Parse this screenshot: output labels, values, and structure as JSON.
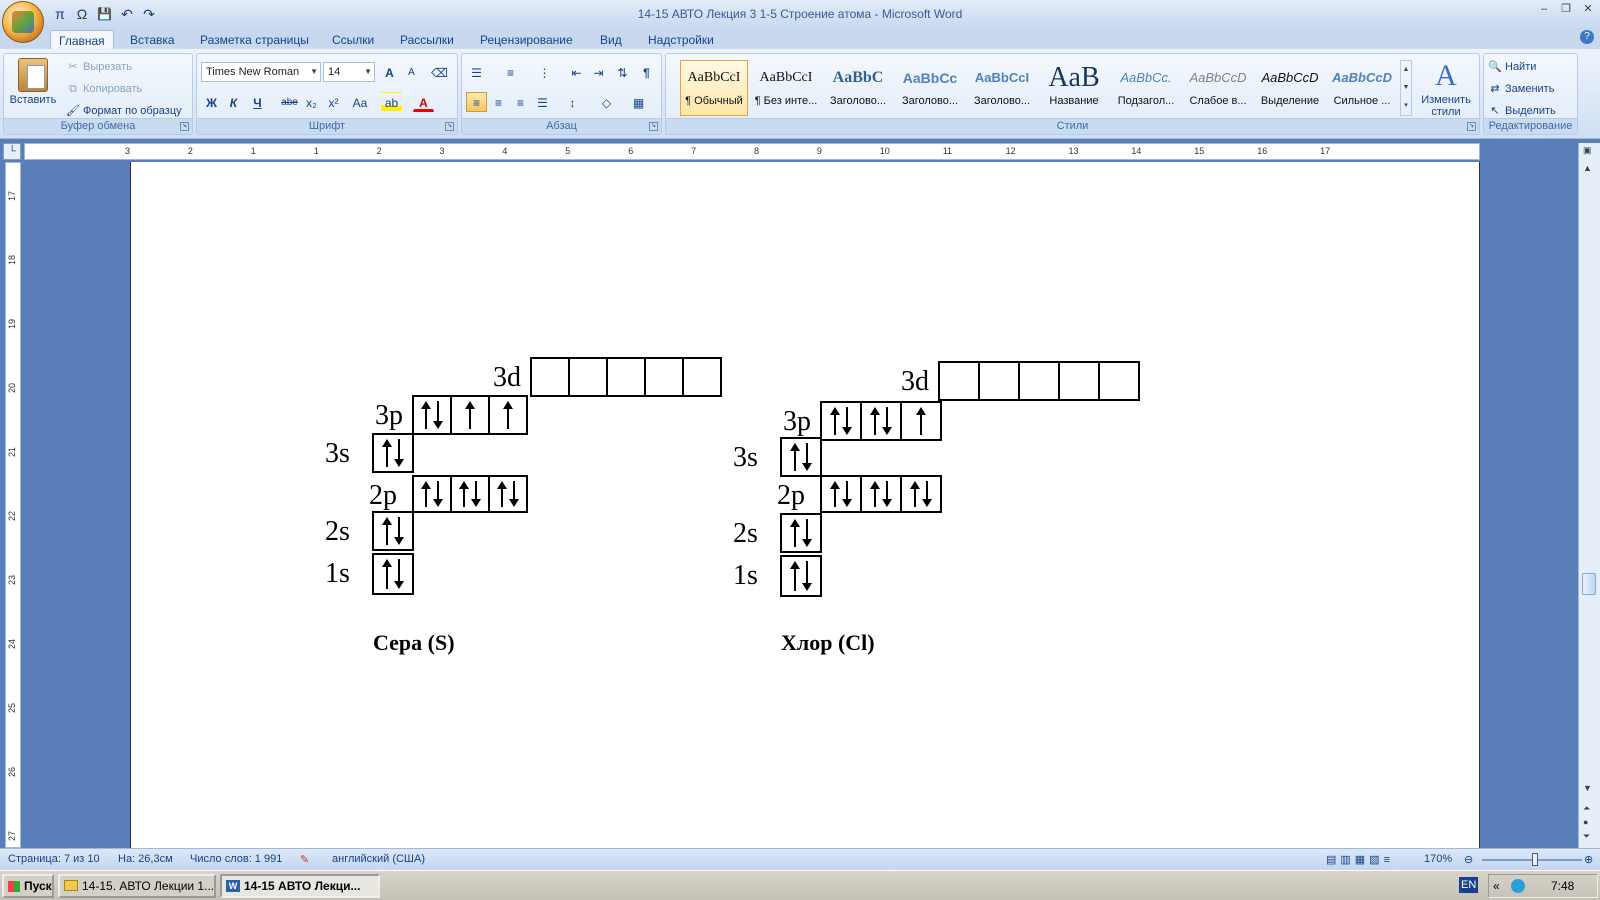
{
  "titlebar": {
    "title": "14-15  АВТО Лекция 3  1-5  Строение  атома - Microsoft Word",
    "qat": [
      "π",
      "Ω",
      "💾",
      "↶",
      "↷"
    ]
  },
  "tabs": [
    "Главная",
    "Вставка",
    "Разметка страницы",
    "Ссылки",
    "Рассылки",
    "Рецензирование",
    "Вид",
    "Надстройки"
  ],
  "clipboard": {
    "paste": "Вставить",
    "cut": "Вырезать",
    "copy": "Копировать",
    "format_painter": "Формат по образцу",
    "label": "Буфер обмена"
  },
  "font": {
    "name": "Times New Roman",
    "size": "14",
    "bold": "Ж",
    "italic": "К",
    "underline": "Ч",
    "strike": "abe",
    "subscript": "x₂",
    "superscript": "x²",
    "case": "Aa",
    "grow": "A",
    "shrink": "A",
    "color_letter": "A",
    "label": "Шрифт"
  },
  "paragraph": {
    "pilcrow": "¶",
    "label": "Абзац"
  },
  "styles": {
    "items": [
      {
        "sample": "AaBbCcI",
        "name": "¶ Обычный"
      },
      {
        "sample": "AaBbCcI",
        "name": "¶ Без инте..."
      },
      {
        "sample": "AaBbC",
        "name": "Заголово..."
      },
      {
        "sample": "AaBbCc",
        "name": "Заголово..."
      },
      {
        "sample": "AaBbCcI",
        "name": "Заголово..."
      },
      {
        "sample": "AaB",
        "name": "Название"
      },
      {
        "sample": "AaBbCc.",
        "name": "Подзагол..."
      },
      {
        "sample": "AaBbCcD",
        "name": "Слабое в..."
      },
      {
        "sample": "AaBbCcD",
        "name": "Выделение"
      },
      {
        "sample": "AaBbCcD",
        "name": "Сильное ..."
      }
    ],
    "change_styles": "Изменить стили",
    "label": "Стили"
  },
  "editing": {
    "find": "Найти",
    "replace": "Заменить",
    "select": "Выделить",
    "label": "Редактирование"
  },
  "ruler": {
    "h_numbers": [
      "3",
      "2",
      "1",
      "1",
      "2",
      "3",
      "4",
      "5",
      "6",
      "7",
      "8",
      "9",
      "10",
      "11",
      "12",
      "13",
      "14",
      "15",
      "16",
      "17"
    ],
    "v_numbers": [
      "17",
      "18",
      "19",
      "20",
      "21",
      "22",
      "23",
      "24",
      "25",
      "26",
      "27"
    ]
  },
  "document": {
    "left": {
      "caption": "Сера  (S)",
      "levels": [
        {
          "label": "3d",
          "cells": [
            "",
            "",
            "",
            "",
            ""
          ]
        },
        {
          "label": "3p",
          "cells": [
            "↑↓",
            "↑",
            "↑"
          ]
        },
        {
          "label": "3s",
          "cells": [
            "↑↓"
          ]
        },
        {
          "label": "2p",
          "cells": [
            "↑↓",
            "↑↓",
            "↑↓"
          ]
        },
        {
          "label": "2s",
          "cells": [
            "↑↓"
          ]
        },
        {
          "label": "1s",
          "cells": [
            "↑↓"
          ]
        }
      ]
    },
    "right": {
      "caption": "Хлор  (Cl)",
      "levels": [
        {
          "label": "3d",
          "cells": [
            "",
            "",
            "",
            "",
            ""
          ]
        },
        {
          "label": "3p",
          "cells": [
            "↑↓",
            "↑↓",
            "↑"
          ]
        },
        {
          "label": "3s",
          "cells": [
            "↑↓"
          ]
        },
        {
          "label": "2p",
          "cells": [
            "↑↓",
            "↑↓",
            "↑↓"
          ]
        },
        {
          "label": "2s",
          "cells": [
            "↑↓"
          ]
        },
        {
          "label": "1s",
          "cells": [
            "↑↓"
          ]
        }
      ]
    }
  },
  "status": {
    "page": "Страница: 7 из 10",
    "position": "На: 26,3см",
    "words": "Число слов: 1 991",
    "language": "английский (США)",
    "zoom": "170%"
  },
  "taskbar": {
    "start": "Пуск",
    "items": [
      "14-15. АВТО  Лекции 1...",
      "14-15   АВТО  Лекци..."
    ],
    "lang": "EN",
    "time": "7:48"
  }
}
